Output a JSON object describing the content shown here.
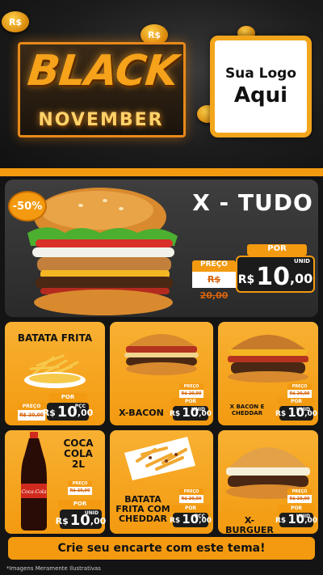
{
  "header": {
    "title_line1": "BLACK",
    "title_line2": "NOVEMBER",
    "coin_symbol": "R$",
    "logo_line1": "Sua Logo",
    "logo_line2": "Aqui"
  },
  "main_product": {
    "discount": "-50%",
    "name": "X - TUDO",
    "preco_label": "PREÇO",
    "old_price": "R$ 20,00",
    "por_label": "POR",
    "currency": "R$",
    "price_int": "10",
    "price_dec": ",00",
    "unit": "UNID"
  },
  "products": [
    {
      "name": "BATATA FRITA",
      "preco_label": "PREÇO",
      "old_price": "R$ 20,00",
      "por_label": "POR",
      "currency": "R$",
      "price_int": "10",
      "price_dec": ",00",
      "unit": "PÇC"
    },
    {
      "name": "X-BACON",
      "preco_label": "PREÇO",
      "old_price": "R$ 20,00",
      "por_label": "POR",
      "currency": "R$",
      "price_int": "10",
      "price_dec": ",00",
      "unit": "UNID"
    },
    {
      "name": "X BACON E CHEDDAR",
      "preco_label": "PREÇO",
      "old_price": "R$ 20,00",
      "por_label": "POR",
      "currency": "R$",
      "price_int": "10",
      "price_dec": ",00",
      "unit": "UNID"
    },
    {
      "name_line1": "COCA",
      "name_line2": "COLA",
      "name_line3": "2L",
      "preco_label": "PREÇO",
      "old_price": "R$ 20,00",
      "por_label": "POR",
      "currency": "R$",
      "price_int": "10",
      "price_dec": ",00",
      "unit": "UNID",
      "bottle_brand": "Coca-Cola"
    },
    {
      "name_line1": "BATATA",
      "name_line2": "FRITA COM",
      "name_line3": "CHEDDAR",
      "preco_label": "PREÇO",
      "old_price": "R$ 20,00",
      "por_label": "POR",
      "currency": "R$",
      "price_int": "10",
      "price_dec": ",00",
      "unit": "PÇC"
    },
    {
      "name": "X-BURGUER",
      "preco_label": "PREÇO",
      "old_price": "R$ 20,00",
      "por_label": "POR",
      "currency": "R$",
      "price_int": "10",
      "price_dec": ",00",
      "unit": "UNID"
    }
  ],
  "banner": {
    "text": "Crie seu encarte com este tema!"
  },
  "footnote": "*Imagens Meramente Ilustrativas",
  "colors": {
    "accent": "#f39a10",
    "dark": "#1b1b1b",
    "old_price_text": "#d8640c"
  }
}
